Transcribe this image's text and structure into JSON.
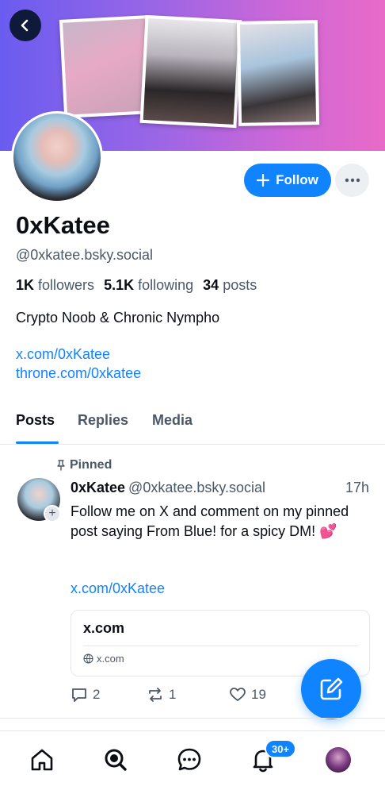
{
  "profile": {
    "display_name": "0xKatee",
    "handle": "@0xkatee.bsky.social",
    "followers_count": "1K",
    "followers_label": "followers",
    "following_count": "5.1K",
    "following_label": "following",
    "posts_count": "34",
    "posts_label": "posts",
    "bio": "Crypto Noob & Chronic Nympho",
    "links": [
      "x.com/0xKatee",
      "throne.com/0xkatee"
    ],
    "follow_label": "Follow"
  },
  "tabs": [
    {
      "label": "Posts",
      "active": true
    },
    {
      "label": "Replies",
      "active": false
    },
    {
      "label": "Media",
      "active": false
    }
  ],
  "post": {
    "pinned_label": "Pinned",
    "author_name": "0xKatee",
    "author_handle": "@0xkatee.bsky.social",
    "time": "17h",
    "text": "Follow me on X and comment on my pinned post saying From Blue! for a spicy DM! 💕",
    "link": "x.com/0xKatee",
    "card": {
      "title": "x.com",
      "domain": "x.com"
    },
    "replies": "2",
    "reposts": "1",
    "likes": "19"
  },
  "nav": {
    "notifications_badge": "30+",
    "items": [
      "home-icon",
      "search-icon",
      "chat-icon",
      "bell-icon",
      "profile-avatar"
    ]
  },
  "colors": {
    "accent": "#1083fe",
    "muted": "#4b5868"
  }
}
